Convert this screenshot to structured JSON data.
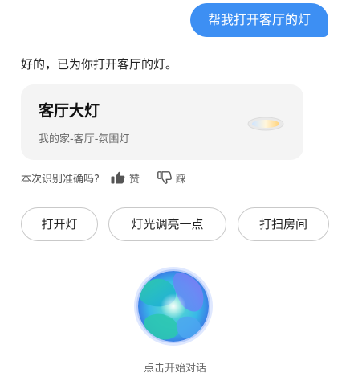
{
  "user_message": "帮我打开客厅的灯",
  "assistant_reply": "好的，已为你打开客厅的灯。",
  "device_card": {
    "name": "客厅大灯",
    "location": "我的家-客厅-氛围灯",
    "icon": "ceiling-lamp-icon"
  },
  "feedback": {
    "question": "本次识别准确吗?",
    "like_label": "赞",
    "dislike_label": "踩",
    "like_icon": "thumbs-up-icon",
    "dislike_icon": "thumbs-down-icon"
  },
  "suggestions": [
    "打开灯",
    "灯光调亮一点",
    "打扫房间"
  ],
  "voice": {
    "hint": "点击开始对话",
    "icon": "voice-orb-icon"
  },
  "colors": {
    "accent": "#3d8ff3",
    "card_bg": "#f4f4f4"
  }
}
